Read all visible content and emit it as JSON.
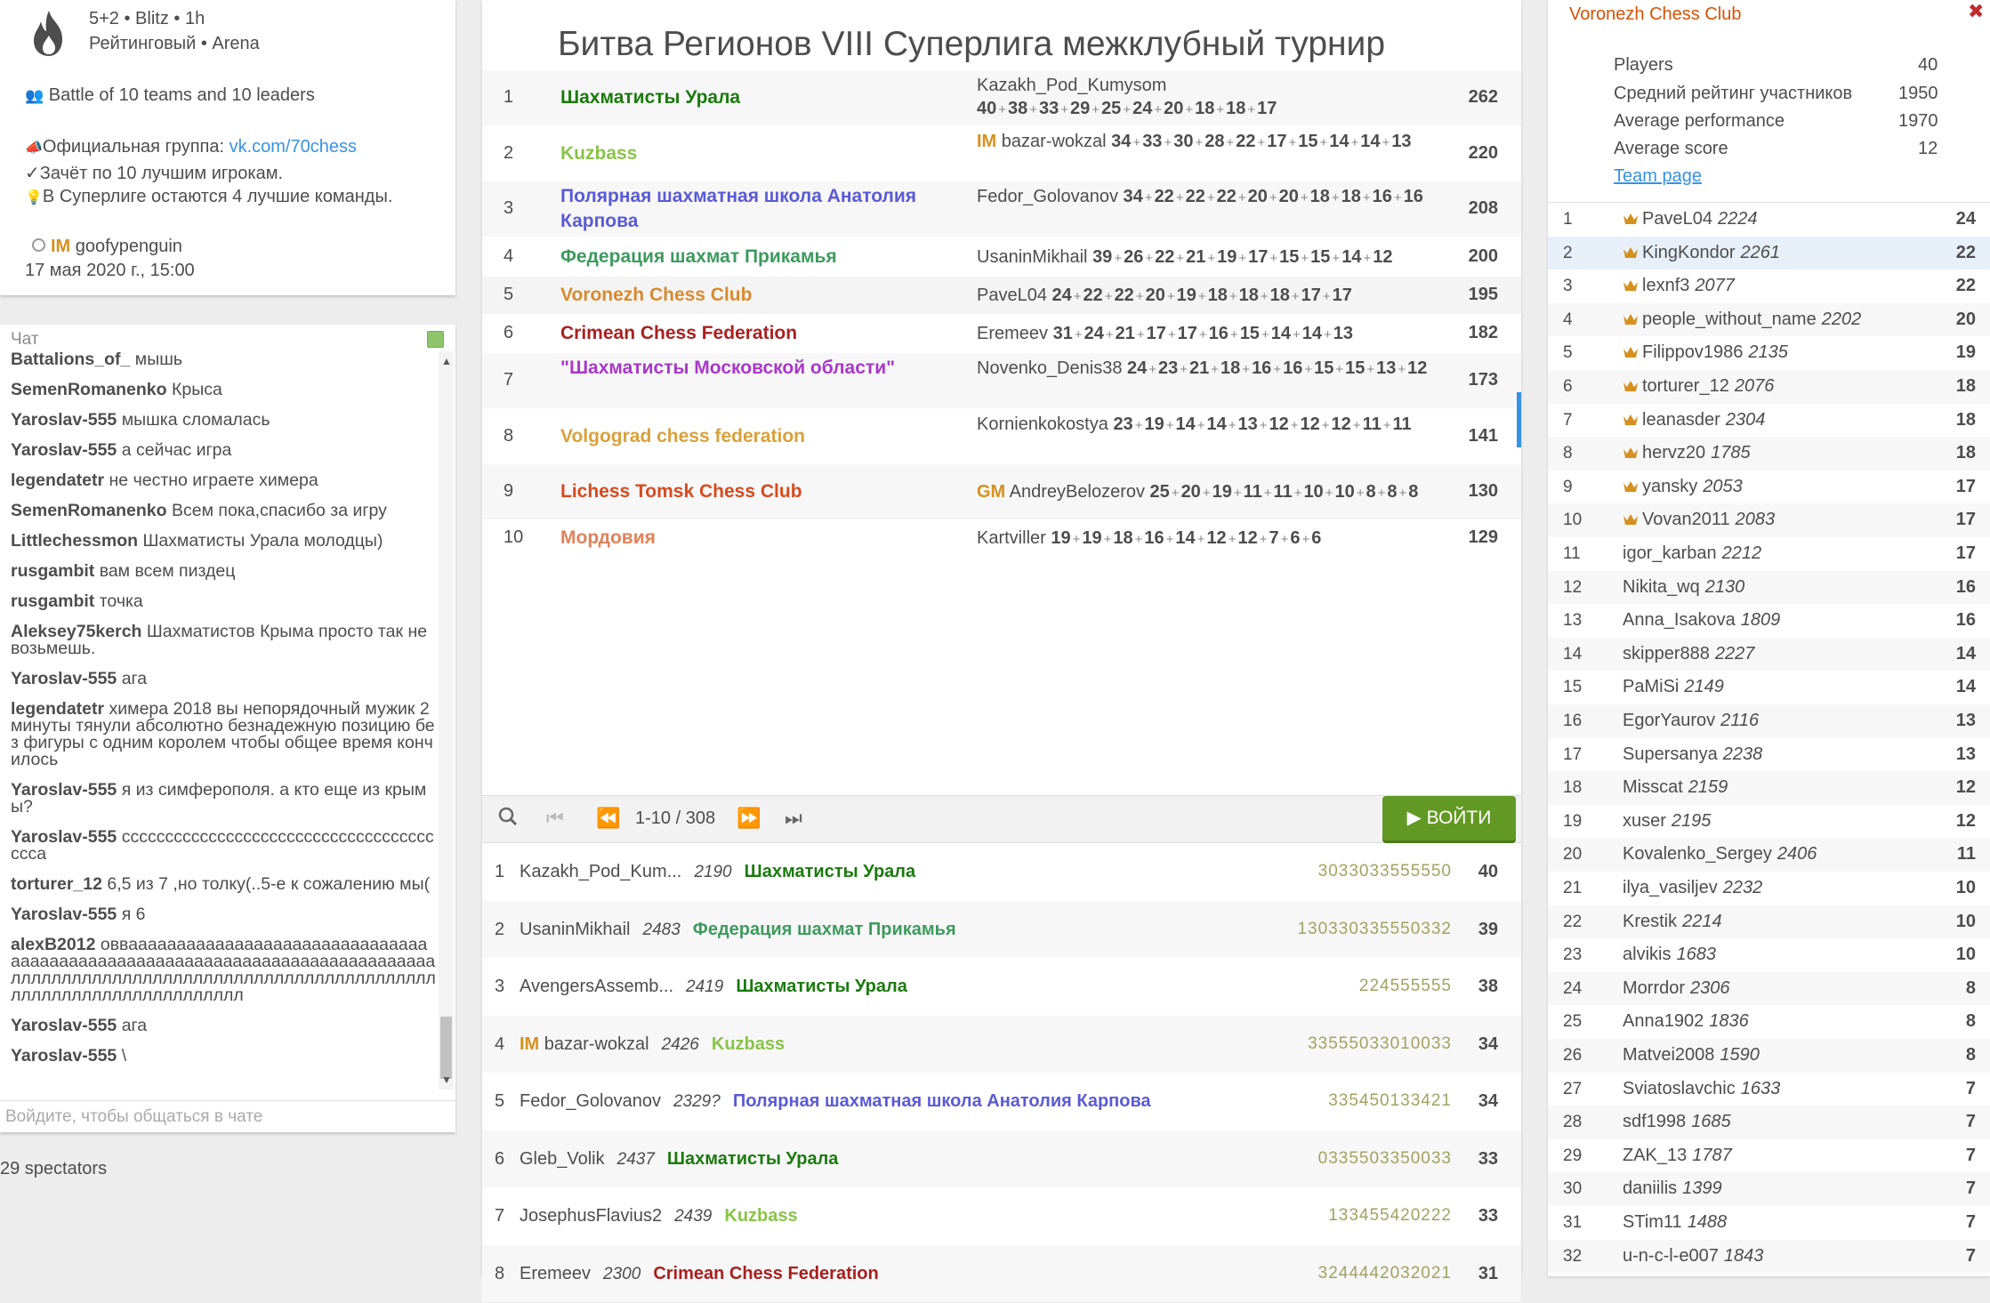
{
  "info": {
    "game_type": "5+2 • Blitz • 1h",
    "arena": "Рейтинговый • Arena",
    "battle": "Battle of 10 teams and 10 leaders",
    "group_prefix": "Официальная группа: ",
    "group_link": "vk.com/70chess",
    "rule1": "Зачёт по 10 лучшим игрокам.",
    "rule2": "В Суперлиге остаются 4 лучшие команды.",
    "creator_title": "IM",
    "creator": "goofypenguin",
    "date": "17 мая 2020 г., 15:00"
  },
  "chat": {
    "title": "Чат",
    "placeholder": "Войдите, чтобы общаться в чате",
    "messages": [
      {
        "user": "Battalions_of_",
        "text": "мышь"
      },
      {
        "user": "SemenRomanenko",
        "text": "Крыса"
      },
      {
        "user": "Yaroslav-555",
        "text": "мышка сломалась"
      },
      {
        "user": "Yaroslav-555",
        "text": "а сейчас игра"
      },
      {
        "user": "legendatetr",
        "text": "не честно играете химера"
      },
      {
        "user": "SemenRomanenko",
        "text": "Всем пока,спасибо за игру"
      },
      {
        "user": "Littlechessmon",
        "text": "Шахматисты Урала молодцы)"
      },
      {
        "user": "rusgambit",
        "text": "вам всем пиздец"
      },
      {
        "user": "rusgambit",
        "text": "точка"
      },
      {
        "user": "Aleksey75kerch",
        "text": "Шахматистов Крыма просто так не возьмешь."
      },
      {
        "user": "Yaroslav-555",
        "text": "ага"
      },
      {
        "user": "legendatetr",
        "text": "химера 2018 вы непорядочный мужик 2 минуты тянули абсолютно безнадежную позицию без фигуры с одним королем чтобы общее время кончилось"
      },
      {
        "user": "Yaroslav-555",
        "text": "я из симферополя. а кто еще из крымы?"
      },
      {
        "user": "Yaroslav-555",
        "text": "ссссссссссссссссссссссссссссссссссссссса"
      },
      {
        "user": "torturer_12",
        "text": "6,5 из 7 ,но толку(..5-е к сожалению мы("
      },
      {
        "user": "Yaroslav-555",
        "text": "я 6"
      },
      {
        "user": "alexB2012",
        "text": "овваааааааааааааааааааааааааааааааааааааааааааааааааааааааааааааааааааааааааааллллллллллллллллллллллллллллллллллллллллллллллллллллллллллллллллл"
      },
      {
        "user": "Yaroslav-555",
        "text": "ага"
      },
      {
        "user": "Yaroslav-555",
        "text": "\\"
      }
    ]
  },
  "spectators": "29 spectators",
  "tournament": {
    "title": "Битва Регионов VIII Суперлига межклубный турнир",
    "teams": [
      {
        "rank": "1",
        "name": "Шахматисты Урала",
        "color": "#1b7a0e",
        "leader": "Kazakh_Pod_Kumysom",
        "leader_title": "",
        "scores": [
          "40",
          "38",
          "33",
          "29",
          "25",
          "24",
          "20",
          "18",
          "18",
          "17"
        ],
        "total": "262"
      },
      {
        "rank": "2",
        "name": "Kuzbass",
        "color": "#8bc34a",
        "leader": "bazar-wokzal",
        "leader_title": "IM",
        "scores": [
          "34",
          "33",
          "30",
          "28",
          "22",
          "17",
          "15",
          "14",
          "14",
          "13"
        ],
        "total": "220"
      },
      {
        "rank": "3",
        "name": "Полярная шахматная школа Анатолия Карпова",
        "color": "#5a5ad6",
        "leader": "Fedor_Golovanov",
        "leader_title": "",
        "scores": [
          "34",
          "22",
          "22",
          "22",
          "20",
          "20",
          "18",
          "18",
          "16",
          "16"
        ],
        "total": "208"
      },
      {
        "rank": "4",
        "name": "Федерация шахмат Прикамья",
        "color": "#3d9a5f",
        "leader": "UsaninMikhail",
        "leader_title": "",
        "scores": [
          "39",
          "26",
          "22",
          "21",
          "19",
          "17",
          "15",
          "15",
          "14",
          "12"
        ],
        "total": "200"
      },
      {
        "rank": "5",
        "name": "Voronezh Chess Club",
        "color": "#d88a2e",
        "leader": "PaveL04",
        "leader_title": "",
        "scores": [
          "24",
          "22",
          "22",
          "20",
          "19",
          "18",
          "18",
          "18",
          "17",
          "17"
        ],
        "total": "195"
      },
      {
        "rank": "6",
        "name": "Crimean Chess Federation",
        "color": "#a82020",
        "leader": "Eremeev",
        "leader_title": "",
        "scores": [
          "31",
          "24",
          "21",
          "17",
          "17",
          "16",
          "15",
          "14",
          "14",
          "13"
        ],
        "total": "182"
      },
      {
        "rank": "7",
        "name": "\"Шахматисты Московской области\"",
        "color": "#a838c8",
        "leader": "Novenko_Denis38",
        "leader_title": "",
        "scores": [
          "24",
          "23",
          "21",
          "18",
          "16",
          "16",
          "15",
          "15",
          "13",
          "12"
        ],
        "total": "173"
      },
      {
        "rank": "8",
        "name": "Volgograd chess federation",
        "color": "#d9a03a",
        "leader": "Kornienkokostya",
        "leader_title": "",
        "scores": [
          "23",
          "19",
          "14",
          "14",
          "13",
          "12",
          "12",
          "12",
          "11",
          "11"
        ],
        "total": "141"
      },
      {
        "rank": "9",
        "name": "Lichess Tomsk Chess Club",
        "color": "#d64a1f",
        "leader": "AndreyBelozerov",
        "leader_title": "GM",
        "scores": [
          "25",
          "20",
          "19",
          "11",
          "11",
          "10",
          "10",
          "8",
          "8",
          "8"
        ],
        "total": "130"
      },
      {
        "rank": "10",
        "name": "Мордовия",
        "color": "#e0825a",
        "leader": "Kartviller",
        "leader_title": "",
        "scores": [
          "19",
          "19",
          "18",
          "16",
          "14",
          "12",
          "12",
          "7",
          "6",
          "6"
        ],
        "total": "129"
      }
    ]
  },
  "pager": {
    "text": "1-10 / 308",
    "join": "ВОЙТИ"
  },
  "players": [
    {
      "rank": "1",
      "title": "",
      "name": "Kazakh_Pod_Kum...",
      "rating": "2190",
      "team": "Шахматисты Урала",
      "team_color": "#1b7a0e",
      "sheet": "3033033555550",
      "score": "40"
    },
    {
      "rank": "2",
      "title": "",
      "name": "UsaninMikhail",
      "rating": "2483",
      "team": "Федерация шахмат Прикамья",
      "team_color": "#3d9a5f",
      "sheet": "130330335550332",
      "score": "39"
    },
    {
      "rank": "3",
      "title": "",
      "name": "AvengersAssemb...",
      "rating": "2419",
      "team": "Шахматисты Урала",
      "team_color": "#1b7a0e",
      "sheet": "224555555",
      "score": "38"
    },
    {
      "rank": "4",
      "title": "IM",
      "name": "bazar-wokzal",
      "rating": "2426",
      "team": "Kuzbass",
      "team_color": "#8bc34a",
      "sheet": "33555033010033",
      "score": "34"
    },
    {
      "rank": "5",
      "title": "",
      "name": "Fedor_Golovanov",
      "rating": "2329?",
      "team": "Полярная шахматная школа Анатолия Карпова",
      "team_color": "#5a5ad6",
      "sheet": "335450133421",
      "score": "34"
    },
    {
      "rank": "6",
      "title": "",
      "name": "Gleb_Volik",
      "rating": "2437",
      "team": "Шахматисты Урала",
      "team_color": "#1b7a0e",
      "sheet": "0335503350033",
      "score": "33"
    },
    {
      "rank": "7",
      "title": "",
      "name": "JosephusFlavius2",
      "rating": "2439",
      "team": "Kuzbass",
      "team_color": "#8bc34a",
      "sheet": "133455420222",
      "score": "33"
    },
    {
      "rank": "8",
      "title": "",
      "name": "Eremeev",
      "rating": "2300",
      "team": "Crimean Chess Federation",
      "team_color": "#a82020",
      "sheet": "3244442032021",
      "score": "31"
    }
  ],
  "team_info": {
    "name": "Voronezh Chess Club",
    "players_label": "Players",
    "players": "40",
    "avg_rating_label": "Средний рейтинг участников",
    "avg_rating": "1950",
    "avg_perf_label": "Average performance",
    "avg_perf": "1970",
    "avg_score_label": "Average score",
    "avg_score": "12",
    "team_page": "Team page"
  },
  "team_players": [
    {
      "rank": "1",
      "name": "PaveL04",
      "rating": "2224",
      "score": "24",
      "crown": true
    },
    {
      "rank": "2",
      "name": "KingKondor",
      "rating": "2261",
      "score": "22",
      "crown": true
    },
    {
      "rank": "3",
      "name": "lexnf3",
      "rating": "2077",
      "score": "22",
      "crown": true
    },
    {
      "rank": "4",
      "name": "people_without_name",
      "rating": "2202",
      "score": "20",
      "crown": true
    },
    {
      "rank": "5",
      "name": "Filippov1986",
      "rating": "2135",
      "score": "19",
      "crown": true
    },
    {
      "rank": "6",
      "name": "torturer_12",
      "rating": "2076",
      "score": "18",
      "crown": true
    },
    {
      "rank": "7",
      "name": "leanasder",
      "rating": "2304",
      "score": "18",
      "crown": true
    },
    {
      "rank": "8",
      "name": "hervz20",
      "rating": "1785",
      "score": "18",
      "crown": true
    },
    {
      "rank": "9",
      "name": "yansky",
      "rating": "2053",
      "score": "17",
      "crown": true
    },
    {
      "rank": "10",
      "name": "Vovan2011",
      "rating": "2083",
      "score": "17",
      "crown": true
    },
    {
      "rank": "11",
      "name": "igor_karban",
      "rating": "2212",
      "score": "17",
      "crown": false
    },
    {
      "rank": "12",
      "name": "Nikita_wq",
      "rating": "2130",
      "score": "16",
      "crown": false
    },
    {
      "rank": "13",
      "name": "Anna_Isakova",
      "rating": "1809",
      "score": "16",
      "crown": false
    },
    {
      "rank": "14",
      "name": "skipper888",
      "rating": "2227",
      "score": "14",
      "crown": false
    },
    {
      "rank": "15",
      "name": "PaMiSi",
      "rating": "2149",
      "score": "14",
      "crown": false
    },
    {
      "rank": "16",
      "name": "EgorYaurov",
      "rating": "2116",
      "score": "13",
      "crown": false
    },
    {
      "rank": "17",
      "name": "Supersanya",
      "rating": "2238",
      "score": "13",
      "crown": false
    },
    {
      "rank": "18",
      "name": "Misscat",
      "rating": "2159",
      "score": "12",
      "crown": false
    },
    {
      "rank": "19",
      "name": "xuser",
      "rating": "2195",
      "score": "12",
      "crown": false
    },
    {
      "rank": "20",
      "name": "Kovalenko_Sergey",
      "rating": "2406",
      "score": "11",
      "crown": false
    },
    {
      "rank": "21",
      "name": "ilya_vasiljev",
      "rating": "2232",
      "score": "10",
      "crown": false
    },
    {
      "rank": "22",
      "name": "Krestik",
      "rating": "2214",
      "score": "10",
      "crown": false
    },
    {
      "rank": "23",
      "name": "alvikis",
      "rating": "1683",
      "score": "10",
      "crown": false
    },
    {
      "rank": "24",
      "name": "Morrdor",
      "rating": "2306",
      "score": "8",
      "crown": false
    },
    {
      "rank": "25",
      "name": "Anna1902",
      "rating": "1836",
      "score": "8",
      "crown": false
    },
    {
      "rank": "26",
      "name": "Matvei2008",
      "rating": "1590",
      "score": "8",
      "crown": false
    },
    {
      "rank": "27",
      "name": "Sviatoslavchic",
      "rating": "1633",
      "score": "7",
      "crown": false
    },
    {
      "rank": "28",
      "name": "sdf1998",
      "rating": "1685",
      "score": "7",
      "crown": false
    },
    {
      "rank": "29",
      "name": "ZAK_13",
      "rating": "1787",
      "score": "7",
      "crown": false
    },
    {
      "rank": "30",
      "name": "daniilis",
      "rating": "1399",
      "score": "7",
      "crown": false
    },
    {
      "rank": "31",
      "name": "STim11",
      "rating": "1488",
      "score": "7",
      "crown": false
    },
    {
      "rank": "32",
      "name": "u-n-c-l-e007",
      "rating": "1843",
      "score": "7",
      "crown": false
    }
  ]
}
